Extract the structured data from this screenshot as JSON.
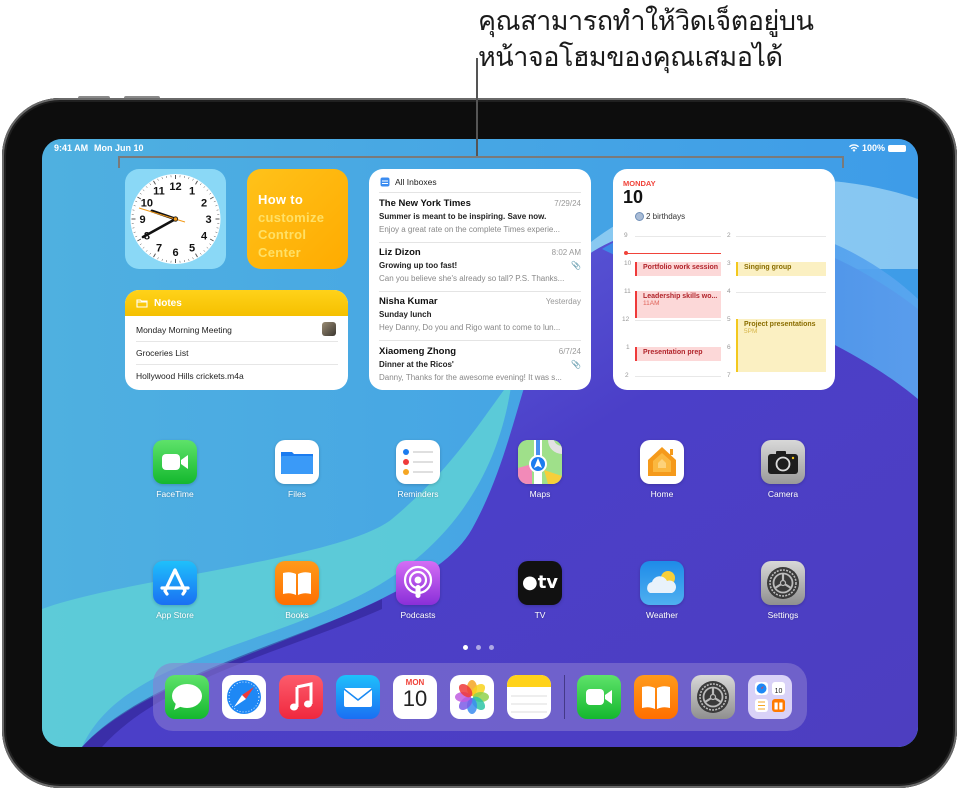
{
  "callout": {
    "lines": [
      "คุณสามารถทำให้วิดเจ็ตอยู่บน",
      "หน้าจอโฮมของคุณเสมอได้"
    ]
  },
  "status_bar": {
    "time": "9:41 AM",
    "date": "Mon Jun 10",
    "battery": "100%",
    "icons": [
      "wifi-icon",
      "battery-icon"
    ]
  },
  "widgets": {
    "clock": {
      "numbers": [
        "12",
        "1",
        "2",
        "3",
        "4",
        "5",
        "6",
        "7",
        "8",
        "9",
        "10",
        "11"
      ],
      "time_shown": "9:41"
    },
    "tip": {
      "line1": "How to",
      "line2": "customize",
      "line3": "Control",
      "line4": "Center",
      "color_primary": "#ffffff",
      "color_secondary": "#ffe066"
    },
    "notes": {
      "title": "Notes",
      "items": [
        {
          "label": "Monday Morning Meeting",
          "has_thumbnail": true
        },
        {
          "label": "Groceries List",
          "has_thumbnail": false
        },
        {
          "label": "Hollywood Hills crickets.m4a",
          "has_thumbnail": false
        }
      ]
    },
    "mail": {
      "title": "All Inboxes",
      "items": [
        {
          "from": "The New York Times",
          "date": "7/29/24",
          "subject": "Summer is meant to be inspiring. Save now.",
          "preview": "Enjoy a great rate on the complete Times experie...",
          "attachment": false
        },
        {
          "from": "Liz Dizon",
          "date": "8:02 AM",
          "subject": "Growing up too fast!",
          "preview": "Can you believe she's already so tall? P.S. Thanks...",
          "attachment": true
        },
        {
          "from": "Nisha Kumar",
          "date": "Yesterday",
          "subject": "Sunday lunch",
          "preview": "Hey Danny, Do you and Rigo want to come to lun...",
          "attachment": false
        },
        {
          "from": "Xiaomeng Zhong",
          "date": "6/7/24",
          "subject": "Dinner at the Ricos'",
          "preview": "Danny, Thanks for the awesome evening! It was s...",
          "attachment": true
        }
      ]
    },
    "calendar": {
      "weekday": "MONDAY",
      "day": "10",
      "birthdays": "2 birthdays",
      "left_hours": [
        "9",
        "10",
        "11",
        "12",
        "1",
        "2"
      ],
      "right_hours": [
        "2",
        "3",
        "4",
        "5",
        "6",
        "7"
      ],
      "events": [
        {
          "title": "Portfolio work session",
          "time": "",
          "color": "red"
        },
        {
          "title": "Leadership skills wo...",
          "time": "11AM",
          "color": "red"
        },
        {
          "title": "Presentation prep",
          "time": "",
          "color": "red"
        },
        {
          "title": "Singing group",
          "time": "",
          "color": "yellow"
        },
        {
          "title": "Project presentations",
          "time": "5PM",
          "color": "yellow"
        }
      ],
      "accent": "#f0433a"
    }
  },
  "apps": [
    {
      "label": "FaceTime",
      "icon": "facetime-icon"
    },
    {
      "label": "Files",
      "icon": "files-icon"
    },
    {
      "label": "Reminders",
      "icon": "reminders-icon"
    },
    {
      "label": "Maps",
      "icon": "maps-icon"
    },
    {
      "label": "Home",
      "icon": "home-icon"
    },
    {
      "label": "Camera",
      "icon": "camera-icon"
    },
    {
      "label": "App Store",
      "icon": "app-store-icon"
    },
    {
      "label": "Books",
      "icon": "books-icon"
    },
    {
      "label": "Podcasts",
      "icon": "podcasts-icon"
    },
    {
      "label": "TV",
      "icon": "tv-icon"
    },
    {
      "label": "Weather",
      "icon": "weather-icon"
    },
    {
      "label": "Settings",
      "icon": "settings-icon"
    }
  ],
  "page_indicator": {
    "pages": 3,
    "current": 1
  },
  "dock": {
    "apps": [
      {
        "name": "Messages",
        "icon": "messages-icon"
      },
      {
        "name": "Safari",
        "icon": "safari-icon"
      },
      {
        "name": "Music",
        "icon": "music-icon"
      },
      {
        "name": "Mail",
        "icon": "mail-icon"
      },
      {
        "name": "Calendar",
        "icon": "calendar-icon",
        "month": "MON",
        "day": "10"
      },
      {
        "name": "Photos",
        "icon": "photos-icon"
      },
      {
        "name": "Notes",
        "icon": "notes-icon"
      }
    ],
    "recent": [
      {
        "name": "FaceTime",
        "icon": "facetime-icon"
      },
      {
        "name": "Books",
        "icon": "books-icon"
      },
      {
        "name": "Settings",
        "icon": "settings-icon"
      },
      {
        "name": "App Library",
        "icon": "app-library-icon"
      }
    ]
  },
  "tv_label": "tv"
}
